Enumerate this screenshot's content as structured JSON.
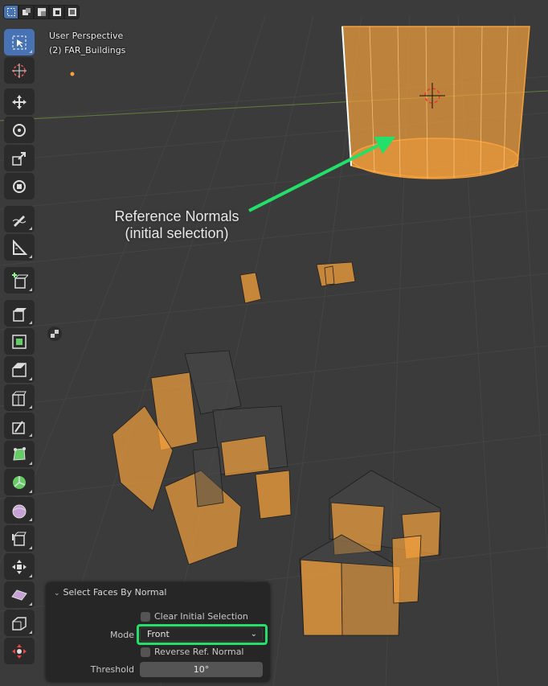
{
  "header": {
    "select_modes": [
      "select-box-icon",
      "select-new-icon",
      "select-extend-icon",
      "select-subtract-icon",
      "select-invert-icon"
    ]
  },
  "viewport": {
    "view_name": "User Perspective",
    "collection": "(2) FAR_Buildings"
  },
  "toolbar": {
    "tools": [
      "select-box-icon",
      "cursor-icon",
      "move-icon",
      "rotate-icon",
      "scale-icon",
      "transform-icon",
      "annotate-icon",
      "measure-icon",
      "add-cube-icon",
      "extrude-icon",
      "inset-icon",
      "bevel-icon",
      "loop-cut-icon",
      "knife-icon",
      "poly-build-icon",
      "spin-icon",
      "smooth-icon",
      "edge-slide-icon",
      "shrink-fatten-icon",
      "shear-icon",
      "rip-icon"
    ]
  },
  "annotation": {
    "line1": "Reference Normals",
    "line2": "(initial selection)",
    "color": "#22e06a"
  },
  "operator_panel": {
    "title": "Select Faces By Normal",
    "clear_initial_selection": "Clear Initial Selection",
    "mode_label": "Mode",
    "mode_value": "Front",
    "reverse_ref_normal": "Reverse Ref. Normal",
    "threshold_label": "Threshold",
    "threshold_value": "10°"
  },
  "colors": {
    "background": "#3b3b3b",
    "selection": "#f5a13c",
    "active_tool": "#4772b3",
    "highlight": "#22e06a"
  }
}
